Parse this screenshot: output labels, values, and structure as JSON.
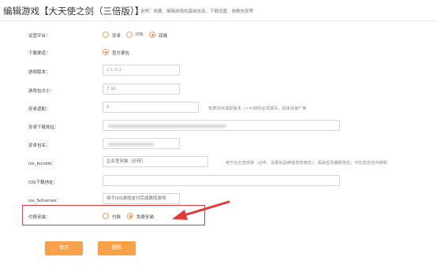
{
  "header": {
    "title": "编辑游戏【大天使之剑（三倍版）】",
    "description": "说明：简要，编辑游戏的基础信息、下载设置、参数信息等"
  },
  "form": {
    "platform": {
      "label": "运营平台：",
      "options": [
        "安卓",
        "IOS",
        "双端"
      ],
      "selected": "双端"
    },
    "download_channel": {
      "label": "下载渠道：",
      "option": "官方渠包",
      "selected": "官方渠包"
    },
    "game_version": {
      "label": "游戏版本：",
      "value": "v 1.0.1"
    },
    "package_size": {
      "label": "游戏包大小：",
      "value": "7.91"
    },
    "android_adapt": {
      "label": "安卓适配：",
      "value": "0",
      "hint": "安卓SDK适配版本（>=38时必须填写，具体请询厂商"
    },
    "android_download_url": {
      "label": "安卓下载地址："
    },
    "android_package": {
      "label": "安卓包名："
    },
    "ios_bundle": {
      "label": "ios_bundle：",
      "value": "企业签安装（必传）",
      "hint": "用于企业签安装（必传，设置如品牌信息安装包），超级签及静默签名，可在签名包中获取"
    },
    "ios_download_url": {
      "label": "IOS下载地址："
    },
    "ios_schemes": {
      "label": "ios_Schemes：",
      "value": "用于IOS游戏支付完成跳回游戏"
    },
    "payment": {
      "label": "付费安装：",
      "options": [
        "付费",
        "免费安装"
      ],
      "selected": "免费安装"
    }
  },
  "actions": {
    "save_label": "保存",
    "delete_label": "删除"
  },
  "colors": {
    "accent": "#f08a24",
    "button": "#f7a14a",
    "annotation": "#e03a3a"
  }
}
